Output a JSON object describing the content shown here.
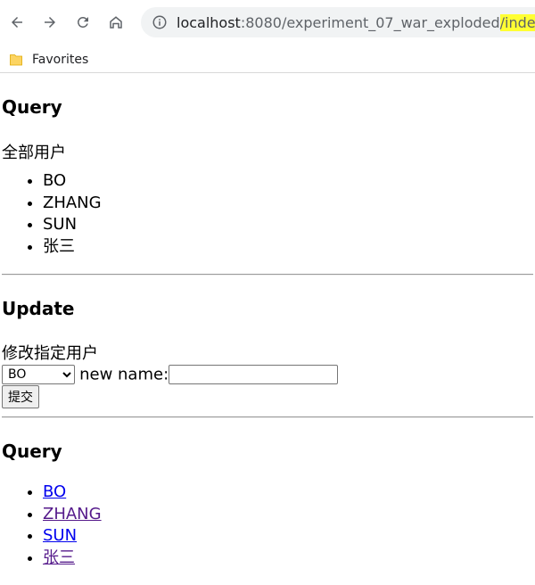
{
  "browser": {
    "url_host": "localhost",
    "url_path": ":8080/experiment_07_war_exploded",
    "url_highlight": "/index",
    "bookmark_folder": "Favorites"
  },
  "query1": {
    "title": "Query",
    "subtitle": "全部用户",
    "users": [
      "BO",
      "ZHANG",
      "SUN",
      "张三"
    ]
  },
  "update": {
    "title": "Update",
    "subtitle": "修改指定用户",
    "select_value": "BO",
    "new_name_label": "new name:",
    "new_name_value": "",
    "submit_label": "提交"
  },
  "query2": {
    "title": "Query",
    "links": [
      "BO",
      "ZHANG",
      "SUN",
      "张三"
    ]
  },
  "colors": {
    "link": "#0000ee",
    "visited_link": "#551a8b",
    "url_highlight": "#ffff33"
  }
}
